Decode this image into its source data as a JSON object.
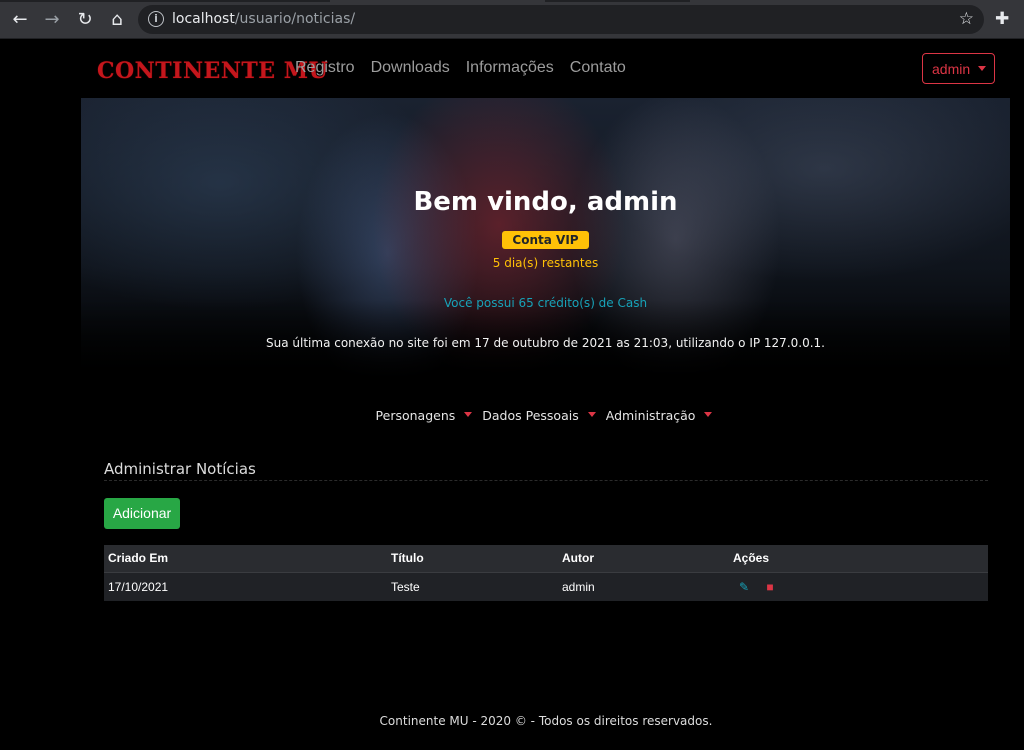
{
  "browser": {
    "url_host": "localhost",
    "url_path": "/usuario/noticias/",
    "back_icon": "arrow-left-icon",
    "forward_icon": "arrow-right-icon",
    "reload_icon": "reload-icon",
    "home_icon": "home-icon"
  },
  "site": {
    "brand": "CONTINENTE MU",
    "menu": [
      "Registro",
      "Downloads",
      "Informações",
      "Contato"
    ],
    "user_button": "admin",
    "colors": {
      "brand": "#c4161c",
      "danger": "#dc3545",
      "warning": "#ffc107",
      "info": "#17a2b8",
      "success": "#28a745"
    }
  },
  "hero": {
    "welcome": "Bem vindo, admin",
    "vip_badge": "Conta VIP",
    "days_left": "5 dia(s) restantes",
    "cash": "Você possui 65 crédito(s) de Cash",
    "last_connection": "Sua última conexão no site foi em 17 de outubro de 2021 as 21:03, utilizando o IP 127.0.0.1."
  },
  "submenu": [
    "Personagens",
    "Dados Pessoais",
    "Administração"
  ],
  "section": {
    "title": "Administrar Notícias",
    "add_button": "Adicionar"
  },
  "table": {
    "headers": [
      "Criado Em",
      "Título",
      "Autor",
      "Ações"
    ],
    "rows": [
      {
        "date": "17/10/2021",
        "title": "Teste",
        "author": "admin"
      }
    ]
  },
  "footer": "Continente MU - 2020 © - Todos os direitos reservados."
}
